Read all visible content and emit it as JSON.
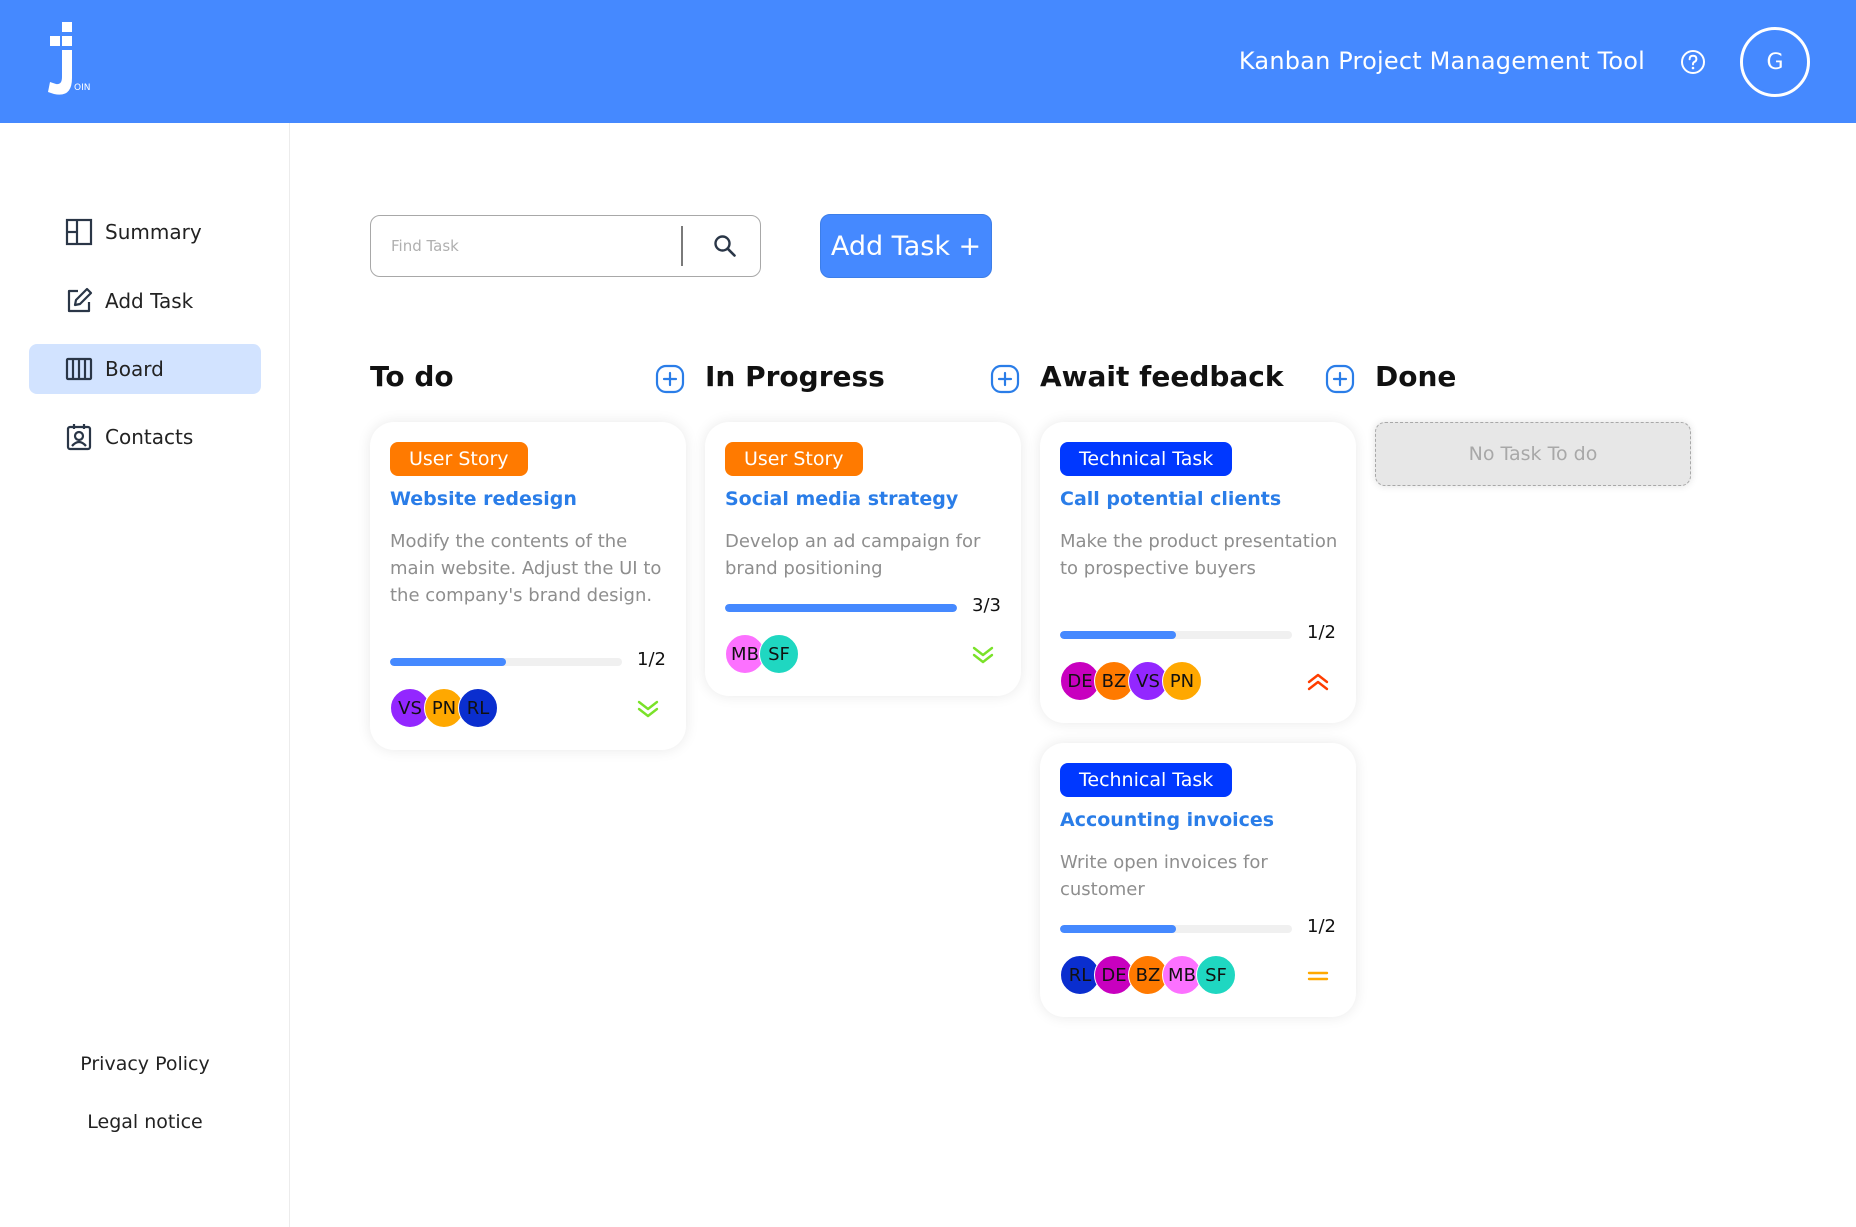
{
  "header": {
    "title": "Kanban Project Management Tool",
    "logo_letter": "J",
    "logo_suffix": "OIN",
    "help_icon": "help-circle-icon",
    "user_initial": "G"
  },
  "sidebar": {
    "items": [
      {
        "label": "Summary",
        "icon": "summary-icon",
        "active": false
      },
      {
        "label": "Add Task",
        "icon": "edit-icon",
        "active": false
      },
      {
        "label": "Board",
        "icon": "board-icon",
        "active": true
      },
      {
        "label": "Contacts",
        "icon": "contacts-icon",
        "active": false
      }
    ],
    "footer": {
      "privacy": "Privacy Policy",
      "legal": "Legal notice"
    }
  },
  "toolbar": {
    "search_placeholder": "Find Task",
    "search_value": "",
    "add_task_label": "Add Task +"
  },
  "columns": [
    {
      "title": "To do"
    },
    {
      "title": "In Progress"
    },
    {
      "title": "Await feedback"
    },
    {
      "title": "Done",
      "empty_text": "No Task To do"
    }
  ],
  "cards": [
    {
      "category": "User Story",
      "title": "Website redesign",
      "description": "Modify the contents of the main website. Adjust the UI to the company's brand design.",
      "subtasks_done": 1,
      "subtasks_total": 2,
      "progress_text": "1/2",
      "assignees": [
        "VS",
        "PN",
        "RL"
      ],
      "priority": "low"
    },
    {
      "category": "User Story",
      "title": "Social media strategy",
      "description": "Develop an ad campaign for brand positioning",
      "subtasks_done": 3,
      "subtasks_total": 3,
      "progress_text": "3/3",
      "assignees": [
        "MB",
        "SF"
      ],
      "priority": "low"
    },
    {
      "category": "Technical Task",
      "title": "Call potential clients",
      "description": "Make the product presentation to prospective buyers",
      "subtasks_done": 1,
      "subtasks_total": 2,
      "progress_text": "1/2",
      "assignees": [
        "DE",
        "BZ",
        "VS",
        "PN"
      ],
      "priority": "urgent"
    },
    {
      "category": "Technical Task",
      "title": "Accounting invoices",
      "description": "Write open invoices for customer",
      "subtasks_done": 1,
      "subtasks_total": 2,
      "progress_text": "1/2",
      "assignees": [
        "RL",
        "DE",
        "BZ",
        "MB",
        "SF"
      ],
      "priority": "medium"
    }
  ],
  "colors": {
    "accent": "#4589FF",
    "user_story": "#FF7A00",
    "technical_task": "#0038FF",
    "title_blue": "#2A7DE8",
    "priority_low": "#7AE229",
    "priority_urgent": "#FF3D00",
    "priority_medium": "#FFA800",
    "avatar_VS": "#9327FF",
    "avatar_PN": "#FFA800",
    "avatar_RL": "#0A2ECF",
    "avatar_MB": "#FC71FF",
    "avatar_SF": "#1FD7C1",
    "avatar_DE": "#C800BF",
    "avatar_BZ": "#FF7A00"
  }
}
